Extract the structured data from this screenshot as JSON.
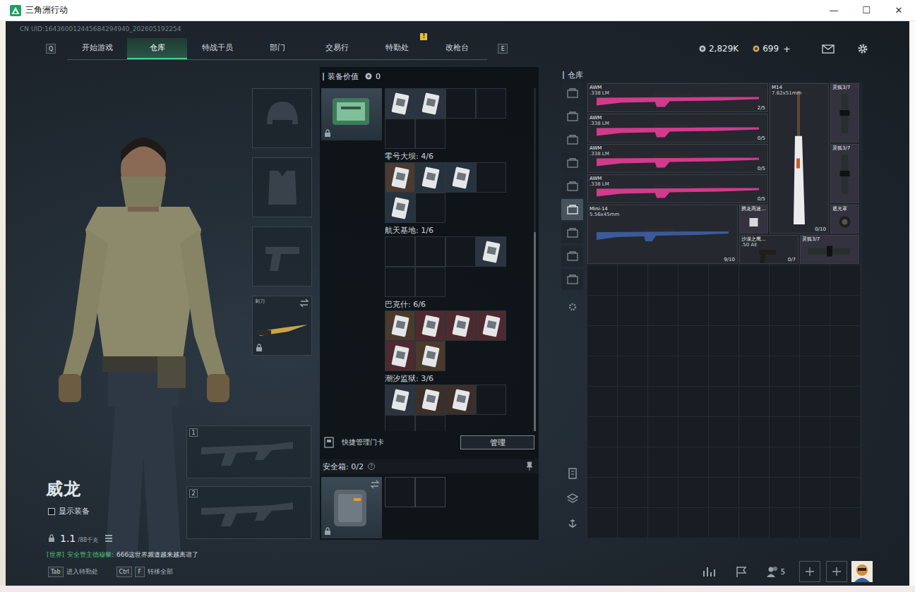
{
  "window": {
    "title": "三角洲行动",
    "controls": [
      "—",
      "☐",
      "✕"
    ]
  },
  "uid": "CN UID:164360012445684294940_202605192254",
  "nav": {
    "keys": [
      "Q",
      "E"
    ],
    "tabs": [
      {
        "label": "开始游戏",
        "selected": false
      },
      {
        "label": "仓库",
        "selected": true
      },
      {
        "label": "特战干员",
        "selected": false
      },
      {
        "label": "部门",
        "selected": false
      },
      {
        "label": "交易行",
        "selected": false
      },
      {
        "label": "特勤处",
        "selected": false,
        "badge": "!"
      },
      {
        "label": "改枪台",
        "selected": false
      }
    ]
  },
  "currency": [
    {
      "value": "2,829K",
      "color": "#b9c0c6"
    },
    {
      "value": "699",
      "add": "+",
      "color": "#d9a24a"
    }
  ],
  "character": {
    "name": "威龙",
    "show_equipment": {
      "label": "显示装备",
      "checked": false
    },
    "weight": {
      "current": "1.1",
      "max": "/88千克"
    }
  },
  "equipment_slots": [
    {
      "kind": "helmet"
    },
    {
      "kind": "armor"
    },
    {
      "kind": "pistol"
    },
    {
      "kind": "melee",
      "label": "刺刀",
      "locked": true
    }
  ],
  "weapon_slots": [
    {
      "number": "1"
    },
    {
      "number": "2"
    }
  ],
  "chat": {
    "channel": "[世界]",
    "sender": "安全管主德穆黎:",
    "message": "666这世界频道越来越离谱了"
  },
  "loadout_panel": {
    "title": "装备价值",
    "value": "0",
    "keycards": {
      "locked": true,
      "scrollbar": {
        "start": 0.42,
        "size": 0.58
      },
      "sections": [
        {
          "cards": [
            {
              "slot": 0,
              "color": "#2b3440"
            },
            {
              "slot": 1,
              "color": "#2b3440"
            }
          ]
        },
        {
          "label": "零号大坝: 4/6",
          "cards": [
            {
              "slot": 0,
              "color": "#4a3a30"
            },
            {
              "slot": 1,
              "color": "#26323e"
            },
            {
              "slot": 2,
              "color": "#26323e"
            },
            {
              "slot": 4,
              "color": "#26323e"
            }
          ]
        },
        {
          "label": "航天基地: 1/6",
          "cards": [
            {
              "slot": 3,
              "color": "#2b3440"
            }
          ]
        },
        {
          "label": "巴克什: 6/6",
          "cards": [
            {
              "slot": 0,
              "color": "#4a3a2c"
            },
            {
              "slot": 1,
              "color": "#4e2a2e"
            },
            {
              "slot": 2,
              "color": "#4e2a2e"
            },
            {
              "slot": 3,
              "color": "#4e2a2e"
            },
            {
              "slot": 4,
              "color": "#4e2a2e"
            },
            {
              "slot": 5,
              "color": "#4a3a2c"
            }
          ]
        },
        {
          "label": "潮汐监狱: 3/6",
          "cards": [
            {
              "slot": 0,
              "color": "#2c3440"
            },
            {
              "slot": 1,
              "color": "#3c2e28"
            },
            {
              "slot": 2,
              "color": "#3c2e28"
            }
          ]
        }
      ]
    },
    "quick_manage": {
      "label": "快捷管理门卡",
      "button": "管理"
    },
    "safe_box": {
      "title": "安全箱: 0/2",
      "help": "?",
      "locked": true,
      "slots": 2
    }
  },
  "warehouse": {
    "title": "仓库",
    "tabs": [
      {
        "selected": false
      },
      {
        "selected": false
      },
      {
        "selected": false
      },
      {
        "selected": false
      },
      {
        "selected": false
      },
      {
        "selected": true
      },
      {
        "selected": false
      },
      {
        "selected": false
      },
      {
        "selected": false
      }
    ],
    "items": [
      {
        "kind": "rifle",
        "name": "AWM",
        "caliber": ".338 LM",
        "ammo": "2/5",
        "color": "#d23a8c",
        "slot": [
          0,
          0,
          6,
          1
        ]
      },
      {
        "kind": "rifle",
        "name": "AWM",
        "caliber": ".338 LM",
        "ammo": "0/5",
        "color": "#d23a8c",
        "slot": [
          0,
          1,
          6,
          1
        ]
      },
      {
        "kind": "rifle",
        "name": "AWM",
        "caliber": ".338 LM",
        "ammo": "0/5",
        "color": "#d23a8c",
        "slot": [
          0,
          2,
          6,
          1
        ]
      },
      {
        "kind": "rifle",
        "name": "AWM",
        "caliber": ".338 LM",
        "ammo": "0/5",
        "color": "#d23a8c",
        "slot": [
          0,
          3,
          6,
          1
        ]
      },
      {
        "kind": "vrifle",
        "name": "M14",
        "caliber": "7.62x51mm",
        "ammo": "0/10",
        "color": "#ececef",
        "slot": [
          6,
          0,
          2,
          5
        ]
      },
      {
        "kind": "scope",
        "name": "灵狐3/7",
        "color": "#2a2d2f",
        "slot": [
          8,
          0,
          1,
          2
        ]
      },
      {
        "kind": "scope",
        "name": "灵狐3/7",
        "color": "#2a2d2f",
        "slot": [
          8,
          2,
          1,
          2
        ]
      },
      {
        "kind": "rifle",
        "name": "Mini-14",
        "caliber": "5.56x45mm",
        "ammo": "9/10",
        "color": "#3b5a9a",
        "slot": [
          0,
          4,
          5,
          2
        ]
      },
      {
        "kind": "muzzle",
        "name": "腾龙高速...",
        "color": "#d8d8d8",
        "slot": [
          5,
          4,
          1,
          1
        ]
      },
      {
        "kind": "hood",
        "name": "遮光罩",
        "color": "#1e1e1e",
        "slot": [
          8,
          4,
          1,
          1
        ]
      },
      {
        "kind": "pistol",
        "name": "沙漠之鹰...",
        "caliber": ".50 AE",
        "ammo": "0/7",
        "color": "#1e1e1e",
        "slot": [
          5,
          5,
          2,
          1
        ]
      },
      {
        "kind": "hscope",
        "name": "灵狐3/7",
        "color": "#2a2d2f",
        "slot": [
          7,
          5,
          2,
          1
        ]
      }
    ]
  },
  "bottom_bar": {
    "hints": [
      {
        "keys": [
          "Tab"
        ],
        "label": "进入特勤处"
      },
      {
        "keys": [
          "Ctrl",
          "F"
        ],
        "label": "转移全部"
      }
    ],
    "friends": "5"
  }
}
